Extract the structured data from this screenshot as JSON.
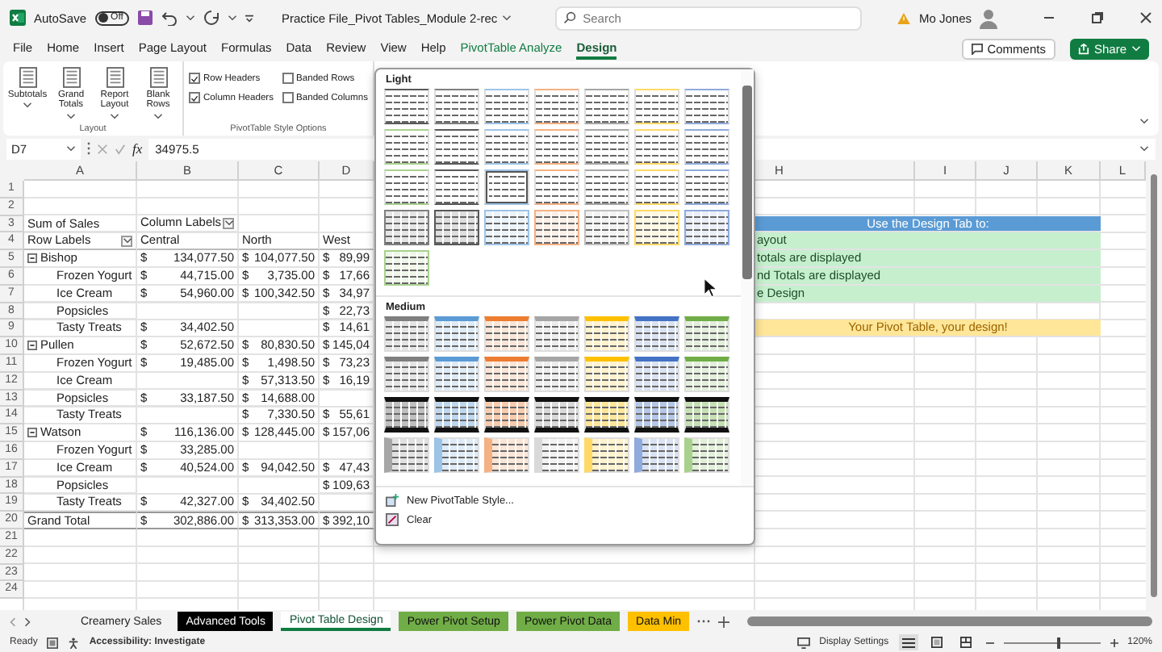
{
  "titlebar": {
    "autosave_label": "AutoSave",
    "autosave": {
      "label": "Off",
      "on": false
    },
    "title": "Practice File_Pivot Tables_Module 2-rec",
    "search": {
      "placeholder": "Search"
    },
    "user": "Mo Jones"
  },
  "menu_tabs": [
    {
      "label": "File",
      "kind": "plain",
      "selected": false
    },
    {
      "label": "Home",
      "kind": "plain",
      "selected": false
    },
    {
      "label": "Insert",
      "kind": "plain",
      "selected": false
    },
    {
      "label": "Page Layout",
      "kind": "plain",
      "selected": false
    },
    {
      "label": "Formulas",
      "kind": "plain",
      "selected": false
    },
    {
      "label": "Data",
      "kind": "plain",
      "selected": false
    },
    {
      "label": "Review",
      "kind": "plain",
      "selected": false
    },
    {
      "label": "View",
      "kind": "plain",
      "selected": false
    },
    {
      "label": "Help",
      "kind": "plain",
      "selected": false
    },
    {
      "label": "PivotTable Analyze",
      "kind": "context",
      "selected": false
    },
    {
      "label": "Design",
      "kind": "context",
      "selected": true
    }
  ],
  "actions": [
    {
      "label": "Comments",
      "kind": "outline"
    },
    {
      "label": "Share",
      "kind": "primary"
    }
  ],
  "ribbon": {
    "layout_group": {
      "label": "Layout",
      "buttons": [
        {
          "label": "Subtotals"
        },
        {
          "label": "Grand Totals"
        },
        {
          "label": "Report Layout"
        },
        {
          "label": "Blank Rows"
        }
      ]
    },
    "options_group": {
      "label": "PivotTable Style Options",
      "options": [
        {
          "label": "Row Headers",
          "checked": true
        },
        {
          "label": "Banded Rows",
          "checked": false
        },
        {
          "label": "Column Headers",
          "checked": true
        },
        {
          "label": "Banded Columns",
          "checked": false
        }
      ]
    }
  },
  "formula_bar": {
    "cell": "D7",
    "function_label": "fx",
    "value": "34975.5"
  },
  "sheet": {
    "columns_left": [
      "A",
      "B",
      "C",
      "D"
    ],
    "columns_right": [
      "H",
      "I",
      "J",
      "K",
      "L"
    ],
    "rows": [
      {
        "number": "1",
        "kind": "blank"
      },
      {
        "number": "2",
        "kind": "blank"
      },
      {
        "number": "3",
        "kind": "caption",
        "label": "Sum of Sales",
        "b": "Column Labels",
        "note": {
          "kind": "heading",
          "text": "Use the Design Tab to:"
        }
      },
      {
        "number": "4",
        "kind": "header",
        "label": "Row Labels",
        "b": "Central",
        "c": "North",
        "d": "West",
        "note": {
          "kind": "item",
          "text": "ayout"
        }
      },
      {
        "number": "5",
        "kind": "group",
        "label": "Bishop",
        "b": {
          "sym": "$",
          "num": "134,077.50"
        },
        "c": {
          "sym": "$",
          "num": "104,077.50"
        },
        "d": {
          "sym": "$",
          "num": "89,99"
        },
        "note": {
          "kind": "item",
          "text": "totals are displayed"
        }
      },
      {
        "number": "6",
        "kind": "item",
        "label": "Frozen Yogurt",
        "b": {
          "sym": "$",
          "num": "44,715.00"
        },
        "c": {
          "sym": "$",
          "num": "3,735.00"
        },
        "d": {
          "sym": "$",
          "num": "17,66"
        },
        "note": {
          "kind": "item",
          "text": "nd Totals are displayed"
        }
      },
      {
        "number": "7",
        "kind": "item",
        "label": "Ice Cream",
        "b": {
          "sym": "$",
          "num": "54,960.00"
        },
        "c": {
          "sym": "$",
          "num": "100,342.50"
        },
        "d": {
          "sym": "$",
          "num": "34,97"
        },
        "note": {
          "kind": "item",
          "text": "e Design"
        }
      },
      {
        "number": "8",
        "kind": "item",
        "label": "Popsicles",
        "d": {
          "sym": "$",
          "num": "22,73"
        }
      },
      {
        "number": "9",
        "kind": "item",
        "label": "Tasty Treats",
        "b": {
          "sym": "$",
          "num": "34,402.50"
        },
        "d": {
          "sym": "$",
          "num": "14,61"
        },
        "note": {
          "kind": "banner",
          "text": "Your Pivot Table, your design!"
        }
      },
      {
        "number": "10",
        "kind": "group",
        "label": "Pullen",
        "b": {
          "sym": "$",
          "num": "52,672.50"
        },
        "c": {
          "sym": "$",
          "num": "80,830.50"
        },
        "d": {
          "sym": "$",
          "num": "145,04"
        }
      },
      {
        "number": "11",
        "kind": "item",
        "label": "Frozen Yogurt",
        "b": {
          "sym": "$",
          "num": "19,485.00"
        },
        "c": {
          "sym": "$",
          "num": "1,498.50"
        },
        "d": {
          "sym": "$",
          "num": "73,23"
        }
      },
      {
        "number": "12",
        "kind": "item",
        "label": "Ice Cream",
        "c": {
          "sym": "$",
          "num": "57,313.50"
        },
        "d": {
          "sym": "$",
          "num": "16,19"
        }
      },
      {
        "number": "13",
        "kind": "item",
        "label": "Popsicles",
        "b": {
          "sym": "$",
          "num": "33,187.50"
        },
        "c": {
          "sym": "$",
          "num": "14,688.00"
        }
      },
      {
        "number": "14",
        "kind": "item",
        "label": "Tasty Treats",
        "c": {
          "sym": "$",
          "num": "7,330.50"
        },
        "d": {
          "sym": "$",
          "num": "55,61"
        }
      },
      {
        "number": "15",
        "kind": "group",
        "label": "Watson",
        "b": {
          "sym": "$",
          "num": "116,136.00"
        },
        "c": {
          "sym": "$",
          "num": "128,445.00"
        },
        "d": {
          "sym": "$",
          "num": "157,06"
        }
      },
      {
        "number": "16",
        "kind": "item",
        "label": "Frozen Yogurt",
        "b": {
          "sym": "$",
          "num": "33,285.00"
        }
      },
      {
        "number": "17",
        "kind": "item",
        "label": "Ice Cream",
        "b": {
          "sym": "$",
          "num": "40,524.00"
        },
        "c": {
          "sym": "$",
          "num": "94,042.50"
        },
        "d": {
          "sym": "$",
          "num": "47,43"
        }
      },
      {
        "number": "18",
        "kind": "item",
        "label": "Popsicles",
        "d": {
          "sym": "$",
          "num": "109,63"
        }
      },
      {
        "number": "19",
        "kind": "item",
        "label": "Tasty Treats",
        "b": {
          "sym": "$",
          "num": "42,327.00"
        },
        "c": {
          "sym": "$",
          "num": "34,402.50"
        }
      },
      {
        "number": "20",
        "kind": "total",
        "label": "Grand Total",
        "b": {
          "sym": "$",
          "num": "302,886.00"
        },
        "c": {
          "sym": "$",
          "num": "313,353.00"
        },
        "d": {
          "sym": "$",
          "num": "392,10"
        }
      },
      {
        "number": "21",
        "kind": "blank"
      },
      {
        "number": "22",
        "kind": "blank"
      },
      {
        "number": "23",
        "kind": "blank"
      },
      {
        "number": "24",
        "kind": "blank"
      }
    ]
  },
  "gallery": {
    "sections": [
      {
        "title": "Light",
        "styles": [
          {
            "kind": "light",
            "color": "#595959",
            "selected": false
          },
          {
            "kind": "light",
            "color": "#7f7f7f",
            "selected": false
          },
          {
            "kind": "light",
            "color": "#9dc3e6",
            "selected": false
          },
          {
            "kind": "light",
            "color": "#f4b183",
            "selected": false
          },
          {
            "kind": "light",
            "color": "#a6a6a6",
            "selected": false
          },
          {
            "kind": "light",
            "color": "#ffd966",
            "selected": false
          },
          {
            "kind": "light",
            "color": "#8faadc",
            "selected": false
          },
          {
            "kind": "light",
            "color": "#a9d18e",
            "selected": false
          },
          {
            "kind": "light",
            "color": "#595959",
            "selected": false
          },
          {
            "kind": "light",
            "color": "#9dc3e6",
            "selected": false
          },
          {
            "kind": "light",
            "color": "#f4b183",
            "selected": false
          },
          {
            "kind": "light",
            "color": "#a6a6a6",
            "selected": false
          },
          {
            "kind": "light",
            "color": "#ffd966",
            "selected": false
          },
          {
            "kind": "light",
            "color": "#8faadc",
            "selected": false
          },
          {
            "kind": "light",
            "color": "#a9d18e",
            "selected": false
          },
          {
            "kind": "light",
            "color": "#595959",
            "selected": false
          },
          {
            "kind": "light",
            "color": "#9dc3e6",
            "selected": true
          },
          {
            "kind": "light",
            "color": "#f4b183",
            "selected": false
          },
          {
            "kind": "light",
            "color": "#a6a6a6",
            "selected": false
          },
          {
            "kind": "light",
            "color": "#ffd966",
            "selected": false
          },
          {
            "kind": "light",
            "color": "#8faadc",
            "selected": false
          },
          {
            "kind": "grid",
            "color": "#7f7f7f",
            "selected": false
          },
          {
            "kind": "grid",
            "color": "#595959",
            "selected": false
          },
          {
            "kind": "grid",
            "color": "#9dc3e6",
            "selected": false
          },
          {
            "kind": "grid",
            "color": "#f4b183",
            "selected": false
          },
          {
            "kind": "grid",
            "color": "#bfbfbf",
            "selected": false
          },
          {
            "kind": "grid",
            "color": "#ffd966",
            "selected": false
          },
          {
            "kind": "grid",
            "color": "#8faadc",
            "selected": false
          },
          {
            "kind": "grid",
            "color": "#a9d18e",
            "selected": false
          }
        ]
      },
      {
        "title": "Medium",
        "styles": [
          {
            "kind": "header",
            "color": "#7f7f7f",
            "selected": false
          },
          {
            "kind": "header",
            "color": "#5b9bd5",
            "selected": false
          },
          {
            "kind": "header",
            "color": "#ed7d31",
            "selected": false
          },
          {
            "kind": "header",
            "color": "#a5a5a5",
            "selected": false
          },
          {
            "kind": "header",
            "color": "#ffc000",
            "selected": false
          },
          {
            "kind": "header",
            "color": "#4472c4",
            "selected": false
          },
          {
            "kind": "header",
            "color": "#70ad47",
            "selected": false
          },
          {
            "kind": "header",
            "color": "#7f7f7f",
            "selected": false
          },
          {
            "kind": "header",
            "color": "#5b9bd5",
            "selected": false
          },
          {
            "kind": "header",
            "color": "#ed7d31",
            "selected": false
          },
          {
            "kind": "header",
            "color": "#a5a5a5",
            "selected": false
          },
          {
            "kind": "header",
            "color": "#ffc000",
            "selected": false
          },
          {
            "kind": "header",
            "color": "#4472c4",
            "selected": false
          },
          {
            "kind": "header",
            "color": "#70ad47",
            "selected": false
          },
          {
            "kind": "dark",
            "color": "#bfbfbf",
            "selected": false
          },
          {
            "kind": "dark",
            "color": "#bdd7ee",
            "selected": false
          },
          {
            "kind": "dark",
            "color": "#f8cbad",
            "selected": false
          },
          {
            "kind": "dark",
            "color": "#d9d9d9",
            "selected": false
          },
          {
            "kind": "dark",
            "color": "#ffe699",
            "selected": false
          },
          {
            "kind": "dark",
            "color": "#b4c7e7",
            "selected": false
          },
          {
            "kind": "dark",
            "color": "#c5e0b4",
            "selected": false
          },
          {
            "kind": "column",
            "color": "#a6a6a6",
            "selected": false
          },
          {
            "kind": "column",
            "color": "#9dc3e6",
            "selected": false
          },
          {
            "kind": "column",
            "color": "#f4b183",
            "selected": false
          },
          {
            "kind": "column",
            "color": "#d9d9d9",
            "selected": false
          },
          {
            "kind": "column",
            "color": "#ffd966",
            "selected": false
          },
          {
            "kind": "column",
            "color": "#8faadc",
            "selected": false
          },
          {
            "kind": "column",
            "color": "#a9d18e",
            "selected": false
          }
        ]
      }
    ],
    "commands": [
      {
        "label": "New PivotTable Style...",
        "kind": "new"
      },
      {
        "label": "Clear",
        "kind": "clear"
      }
    ]
  },
  "sheet_tabs": [
    {
      "label": "Creamery Sales",
      "selected": false
    },
    {
      "label": "Advanced Tools",
      "selected": false,
      "color": "#000000"
    },
    {
      "label": "Pivot Table Design",
      "selected": true
    },
    {
      "label": "Power Pivot Setup",
      "selected": false,
      "color": "#70ad47"
    },
    {
      "label": "Power Pivot Data",
      "selected": false,
      "color": "#70ad47"
    },
    {
      "label": "Data Min",
      "selected": false,
      "color": "#ffc000"
    }
  ],
  "status_bar": {
    "mode": "Ready",
    "accessibility": "Accessibility: Investigate",
    "display_settings": "Display Settings",
    "views": [
      {
        "kind": "normal",
        "selected": true
      },
      {
        "kind": "page-layout",
        "selected": false
      },
      {
        "kind": "page-break",
        "selected": false
      }
    ],
    "zoom": {
      "level": 0.55,
      "reading": "120%"
    }
  }
}
